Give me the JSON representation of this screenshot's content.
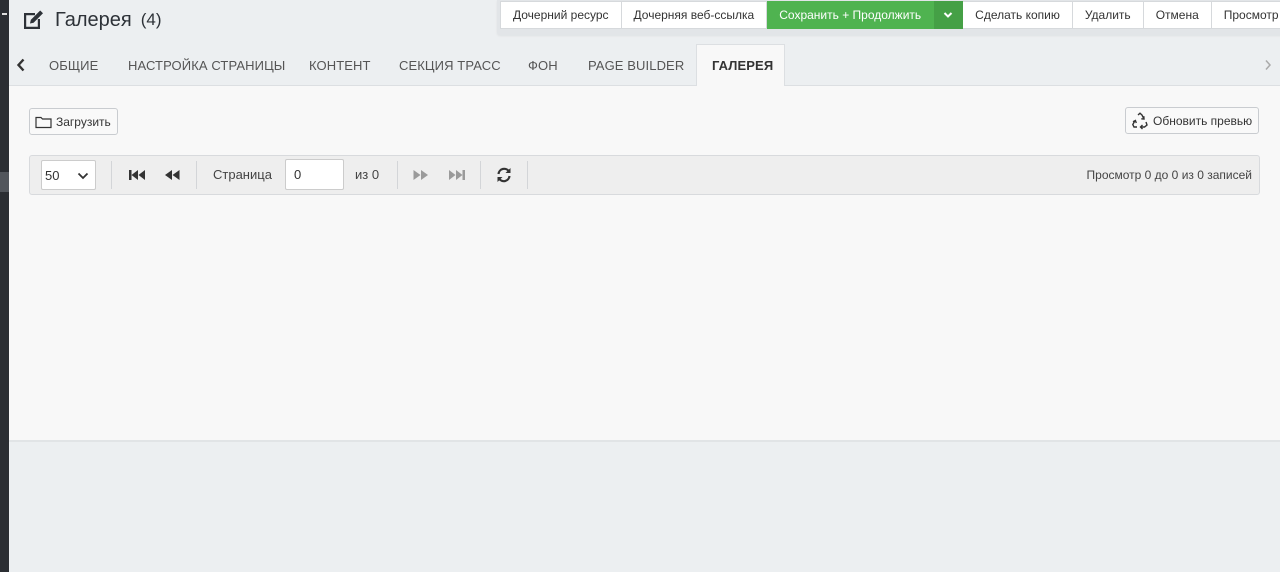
{
  "header": {
    "title": "Галерея",
    "count": "(4)",
    "title_icon": "edit-icon"
  },
  "toolbar": {
    "child_resource": "Дочерний ресурс",
    "child_weblink": "Дочерняя веб-ссылка",
    "save_continue": "Сохранить + Продолжить",
    "duplicate": "Сделать копию",
    "delete": "Удалить",
    "cancel": "Отмена",
    "view": "Просмотр",
    "primary_color": "#4fb350"
  },
  "tabs": [
    {
      "label": "ОБЩИЕ"
    },
    {
      "label": "НАСТРОЙКА СТРАНИЦЫ"
    },
    {
      "label": "КОНТЕНТ"
    },
    {
      "label": "СЕКЦИЯ ТРАСС"
    },
    {
      "label": "ФОН"
    },
    {
      "label": "PAGE BUILDER"
    },
    {
      "label": "ГАЛЕРЕЯ",
      "active": true
    }
  ],
  "gallery": {
    "upload_label": "Загрузить",
    "refresh_preview_label": "Обновить превью"
  },
  "pager": {
    "page_size": "50",
    "page_label": "Страница",
    "page_value": "0",
    "of_label": "из 0",
    "summary": "Просмотр 0 до 0 из 0 записей"
  }
}
